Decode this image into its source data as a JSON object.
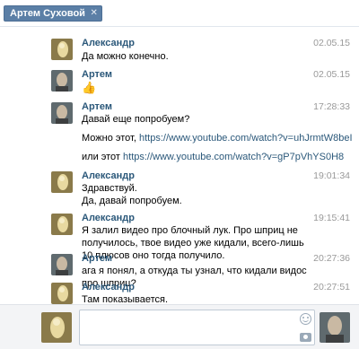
{
  "header": {
    "chip_label": "Артем Суховой",
    "close_glyph": "✕"
  },
  "messages": [
    {
      "author": "Александр",
      "time": "02.05.15",
      "text": "Да можно конечно.",
      "avatar": "avatar-alexander"
    },
    {
      "author": "Артем",
      "time": "02.05.15",
      "text": "👍",
      "avatar": "avatar-artem"
    },
    {
      "author": "Артем",
      "time": "17:28:33",
      "text_line1": "Давай еще попробуем?",
      "text_line2_prefix": "Можно этот, ",
      "link1": "https://www.youtube.com/watch?v=uhJrmtW8beI",
      "text_line3_prefix": "или этот ",
      "link2": "https://www.youtube.com/watch?v=gP7pVhYS0H8",
      "avatar": "avatar-artem"
    },
    {
      "author": "Александр",
      "time": "19:01:34",
      "text": "Здравствуй.\nДа, давай попробуем.",
      "avatar": "avatar-alexander"
    },
    {
      "author": "Александр",
      "time": "19:15:41",
      "text": "Я залил видео про блочный лук. Про шприц не получилось, твое видео уже кидали, всего-лишь 10 плюсов оно тогда получило.",
      "avatar": "avatar-alexander"
    },
    {
      "author": "Артем",
      "time": "20:27:36",
      "text": "ага я понял, а откуда ты узнал, что кидали видос про шприц?",
      "avatar": "avatar-artem"
    },
    {
      "author": "Александр",
      "time": "20:27:51",
      "text": "Там показывается.",
      "avatar": "avatar-alexander"
    }
  ],
  "colors": {
    "chip_bg": "#5b7fa6",
    "author_link": "#2b587a",
    "timestamp": "#999999",
    "composer_bg": "#f3f4f6"
  }
}
